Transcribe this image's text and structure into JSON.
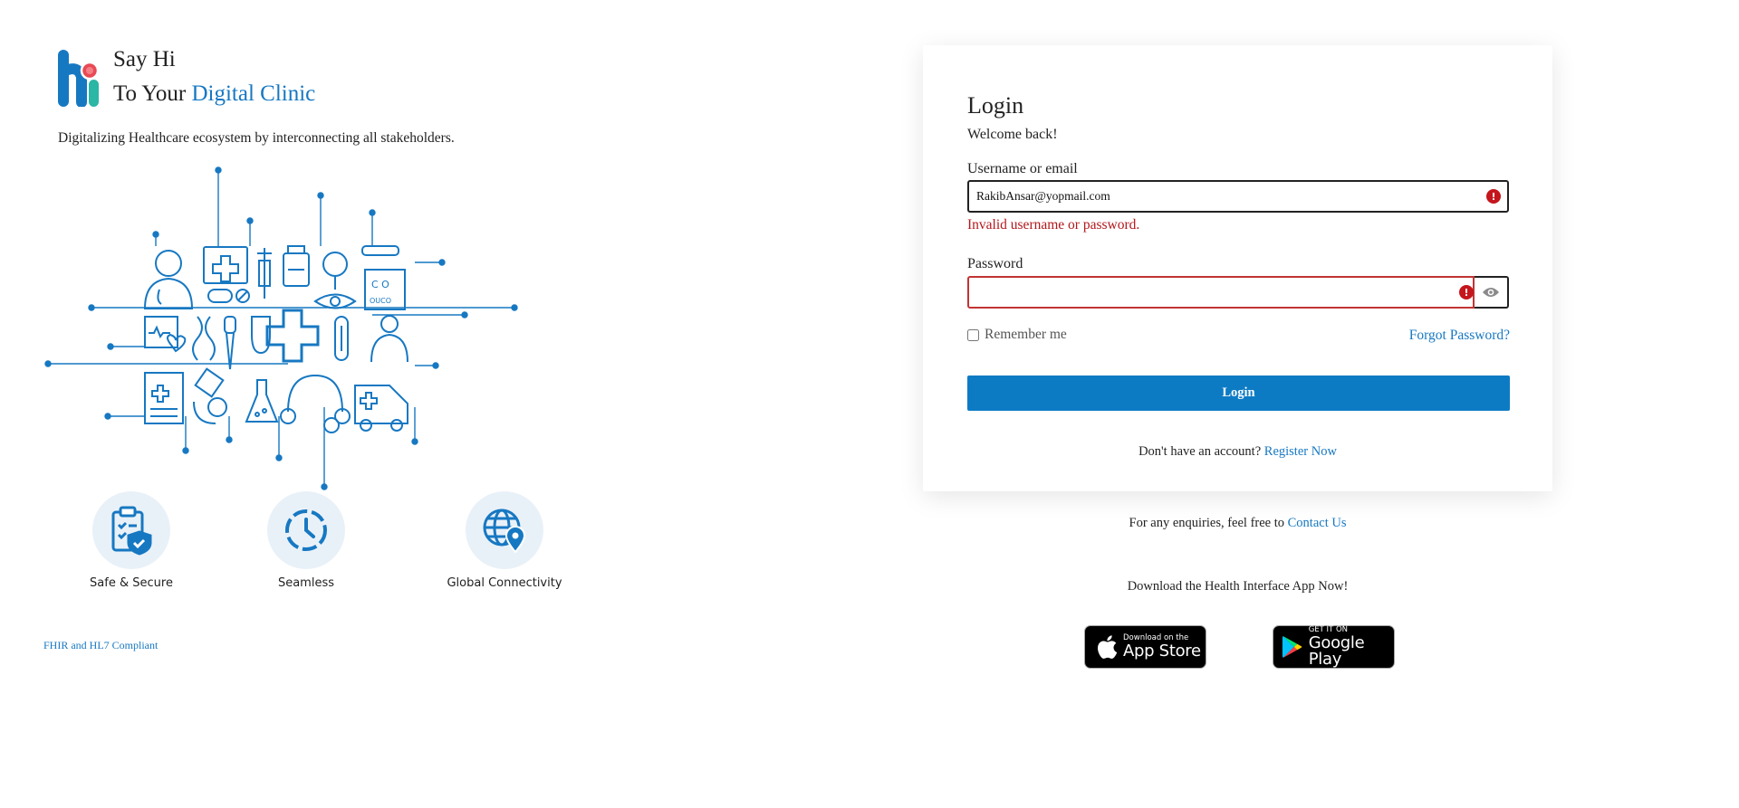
{
  "brand": {
    "say_hi": "Say Hi",
    "to_your": "To Your ",
    "digital_clinic": "Digital Clinic",
    "tagline": "Digitalizing Healthcare ecosystem by interconnecting all stakeholders.",
    "accent_color": "#1778c2"
  },
  "features": [
    {
      "label": "Safe & Secure",
      "icon": "clipboard-shield-icon"
    },
    {
      "label": "Seamless",
      "icon": "clock-icon"
    },
    {
      "label": "Global Connectivity",
      "icon": "globe-pin-icon"
    }
  ],
  "compliance": "FHIR and HL7 Compliant",
  "login": {
    "title": "Login",
    "welcome": "Welcome back!",
    "username_label": "Username or email",
    "username_value": "RakibAnsar@yopmail.com",
    "error_message": "Invalid username or password.",
    "password_label": "Password",
    "password_value": "",
    "remember_label": "Remember me",
    "forgot_label": "Forgot Password?",
    "button_label": "Login",
    "no_account_text": "Don't have an account? ",
    "register_label": "Register Now"
  },
  "footer": {
    "enquiry_text": "For any enquiries, feel free to ",
    "contact_label": "Contact Us",
    "download_text": "Download the Health Interface App Now!",
    "appstore_small": "Download on the",
    "appstore_big": "App Store",
    "gplay_small": "GET IT ON",
    "gplay_big": "Google Play"
  },
  "colors": {
    "primary_button": "#0d7bc4",
    "error": "#b3171b",
    "error_border": "#c23434"
  }
}
